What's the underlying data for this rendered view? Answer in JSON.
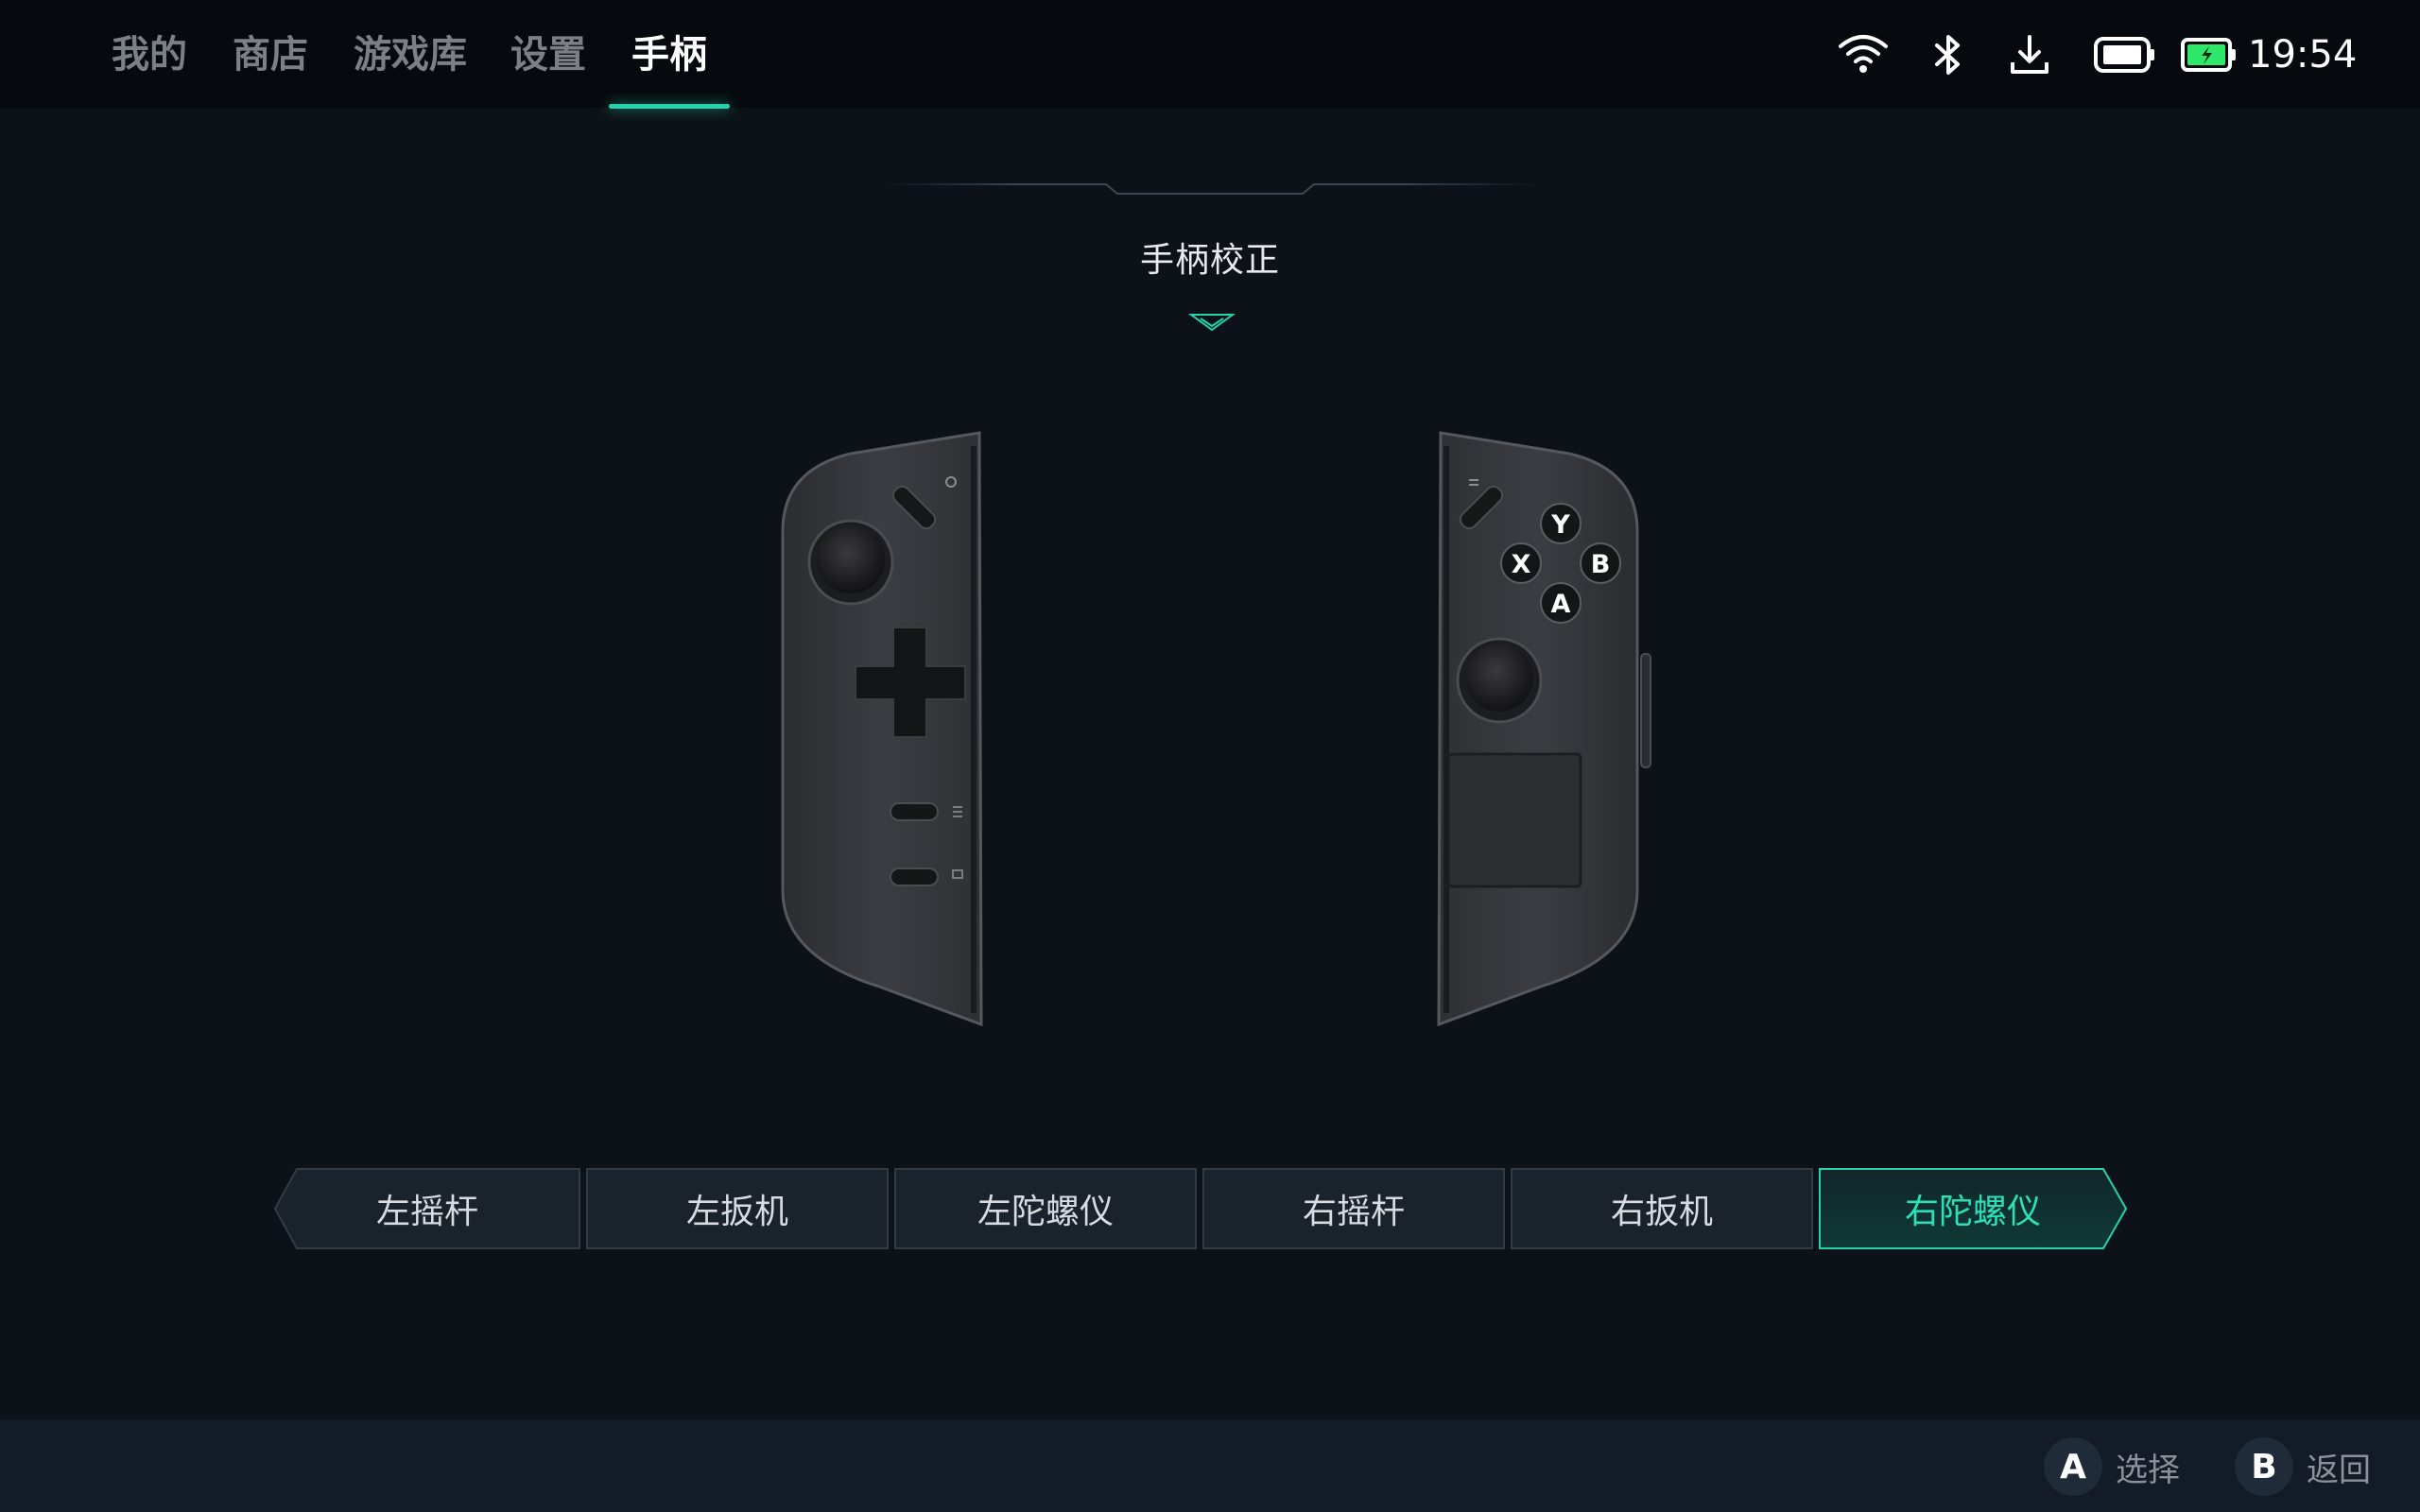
{
  "nav": {
    "tabs": [
      {
        "label": "我的"
      },
      {
        "label": "商店"
      },
      {
        "label": "游戏库"
      },
      {
        "label": "设置"
      },
      {
        "label": "手柄",
        "active": true
      }
    ]
  },
  "status": {
    "time": "19:54",
    "icons": [
      "wifi-icon",
      "bluetooth-icon",
      "download-icon",
      "device-battery-icon",
      "battery-charging-icon"
    ],
    "accent_color": "#22d3ac",
    "battery_color": "#2ee86a"
  },
  "main": {
    "title": "手柄校正",
    "left_controller": {
      "buttons": [
        "left-stick",
        "d-pad",
        "menu-button",
        "view-button",
        "capture-button"
      ]
    },
    "right_controller": {
      "face_buttons": [
        "Y",
        "X",
        "B",
        "A"
      ],
      "buttons": [
        "right-stick",
        "touchpad",
        "home-button"
      ]
    }
  },
  "options": [
    {
      "label": "左摇杆"
    },
    {
      "label": "左扳机"
    },
    {
      "label": "左陀螺仪"
    },
    {
      "label": "右摇杆"
    },
    {
      "label": "右扳机"
    },
    {
      "label": "右陀螺仪",
      "selected": true
    }
  ],
  "footer": {
    "hints": [
      {
        "key": "A",
        "label": "选择"
      },
      {
        "key": "B",
        "label": "返回"
      }
    ]
  }
}
